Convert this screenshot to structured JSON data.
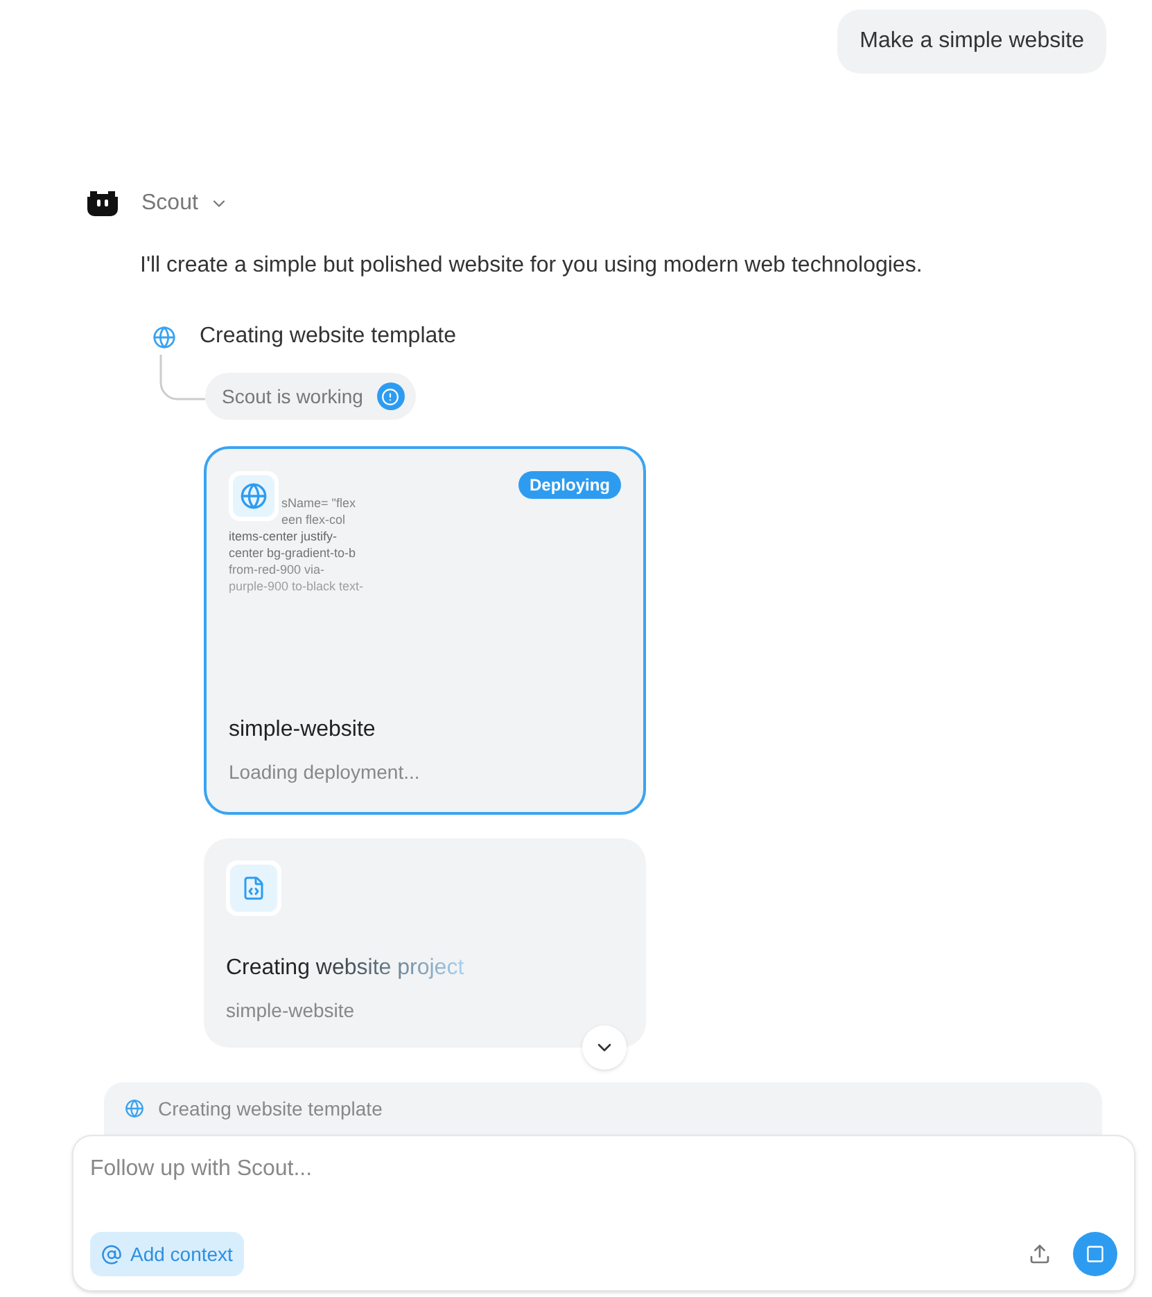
{
  "user_message": "Make a simple website",
  "assistant": {
    "name": "Scout",
    "intro": "I'll create a simple but polished website for you using modern web technologies."
  },
  "step": {
    "title": "Creating website template",
    "status": "Scout is working"
  },
  "deploy_card": {
    "badge": "Deploying",
    "code_lines": [
      "sName= \"flex",
      "een flex-col",
      "items-center justify-",
      "center bg-gradient-to-b",
      "from-red-900 via-",
      "purple-900 to-black text-"
    ],
    "title": "simple-website",
    "subtitle": "Loading deployment..."
  },
  "project_card": {
    "title": "Creating website project",
    "subtitle": "simple-website"
  },
  "task_panel": {
    "title": "Creating website template"
  },
  "composer": {
    "placeholder": "Follow up with Scout...",
    "context_button": "Add context"
  }
}
